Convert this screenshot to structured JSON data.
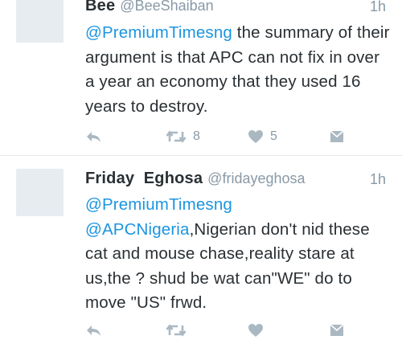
{
  "tweets": [
    {
      "name": "Bee",
      "handle": "@BeeShaiban",
      "time": "1h",
      "mention1": "@PremiumTimesng",
      "text_part1": " the summary of their argument is that APC can not fix in over a year an economy that they used 16 years to destroy.",
      "retweet_count": "8",
      "like_count": "5",
      "icons": [
        "reply-icon",
        "retweet-icon",
        "heart-icon",
        "dm-icon"
      ]
    },
    {
      "name": "Friday  Eghosa",
      "handle": "@fridayeghosa",
      "time": "1h",
      "mention1": "@PremiumTimesng",
      "mention2": "@APCNigeria",
      "text_part1": ",Nigerian don't nid these cat and mouse chase,reality stare at us,the ? shud be wat can\"WE\" do to move \"US\" frwd.",
      "retweet_count": "",
      "like_count": "",
      "icons": [
        "reply-icon",
        "retweet-icon",
        "heart-icon",
        "dm-icon"
      ]
    }
  ],
  "colors": {
    "link": "#1b95e0",
    "text": "#292f33",
    "muted": "#8899a6",
    "icon": "#aab8c2",
    "divider": "#e1e8ed"
  }
}
